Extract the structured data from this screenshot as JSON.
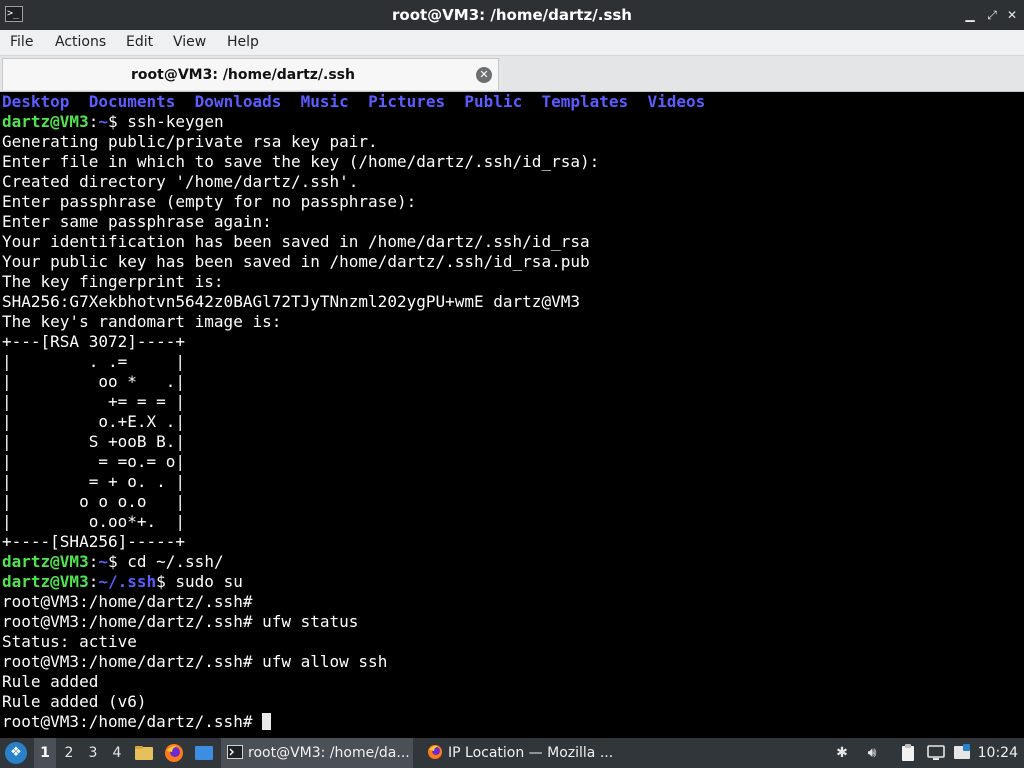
{
  "window": {
    "title": "root@VM3: /home/dartz/.ssh",
    "app_icon": "terminal-icon",
    "controls": [
      "minimize-icon",
      "maximize-icon",
      "close-icon"
    ]
  },
  "menu": {
    "items": [
      "File",
      "Actions",
      "Edit",
      "View",
      "Help"
    ]
  },
  "tab": {
    "label": "root@VM3: /home/dartz/.ssh",
    "close_icon": "close-circle-icon"
  },
  "terminal": {
    "dirs": [
      "Desktop",
      "Documents",
      "Downloads",
      "Music",
      "Pictures",
      "Public",
      "Templates",
      "Videos"
    ],
    "user_host": "dartz@VM3",
    "prompt_sep": ":",
    "home_path": "~",
    "ssh_path": "~/.ssh",
    "cmd1": "ssh-keygen",
    "output1": [
      "Generating public/private rsa key pair.",
      "Enter file in which to save the key (/home/dartz/.ssh/id_rsa):",
      "Created directory '/home/dartz/.ssh'.",
      "Enter passphrase (empty for no passphrase):",
      "Enter same passphrase again:",
      "Your identification has been saved in /home/dartz/.ssh/id_rsa",
      "Your public key has been saved in /home/dartz/.ssh/id_rsa.pub",
      "The key fingerprint is:",
      "SHA256:G7Xekbhotvn5642z0BAGl72TJyTNnzml202ygPU+wmE dartz@VM3",
      "The key's randomart image is:",
      "+---[RSA 3072]----+",
      "|        . .=     |",
      "|         oo *   .|",
      "|          += = = |",
      "|         o.+E.X .|",
      "|        S +ooB B.|",
      "|         = =o.= o|",
      "|        = + o. . |",
      "|       o o o.o   |",
      "|        o.oo*+.  |",
      "+----[SHA256]-----+"
    ],
    "cmd2": "cd ~/.ssh/",
    "cmd3": "sudo su",
    "root_prompt": "root@VM3:/home/dartz/.ssh#",
    "cmd4": "ufw status",
    "output4": "Status: active",
    "cmd5": "ufw allow ssh",
    "output5": [
      "Rule added",
      "Rule added (v6)"
    ]
  },
  "taskbar": {
    "workspaces": [
      "1",
      "2",
      "3",
      "4"
    ],
    "active_workspace": "1",
    "tasks": [
      {
        "label": "root@VM3: /home/da...",
        "icon": "terminal-icon"
      },
      {
        "label": "IP Location — Mozilla ...",
        "icon": "firefox-icon"
      }
    ],
    "clock": "10:24",
    "colors": {
      "background": "#31363b",
      "accent": "#2a80c9"
    }
  }
}
